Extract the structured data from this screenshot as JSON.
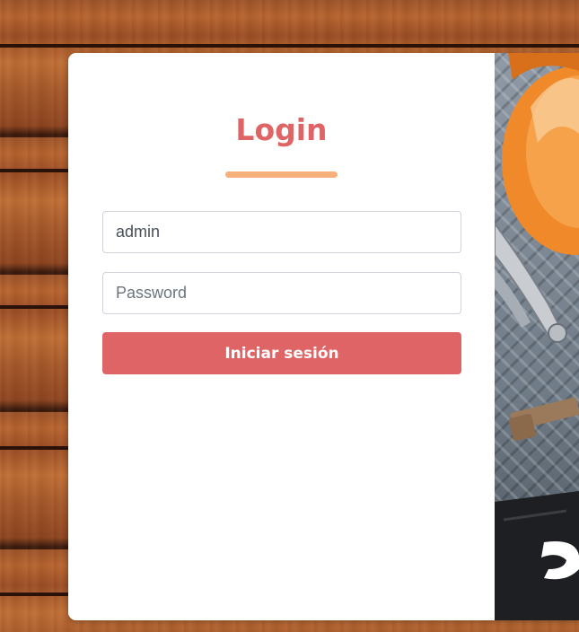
{
  "login": {
    "title": "Login",
    "username_value": "admin",
    "password_placeholder": "Password",
    "submit_label": "Iniciar sesión"
  },
  "colors": {
    "accent": "#df6466",
    "underline": "#f7b07c",
    "card_background": "#ffffff"
  },
  "side_image": {
    "description_icon": "construction-tools-image"
  }
}
